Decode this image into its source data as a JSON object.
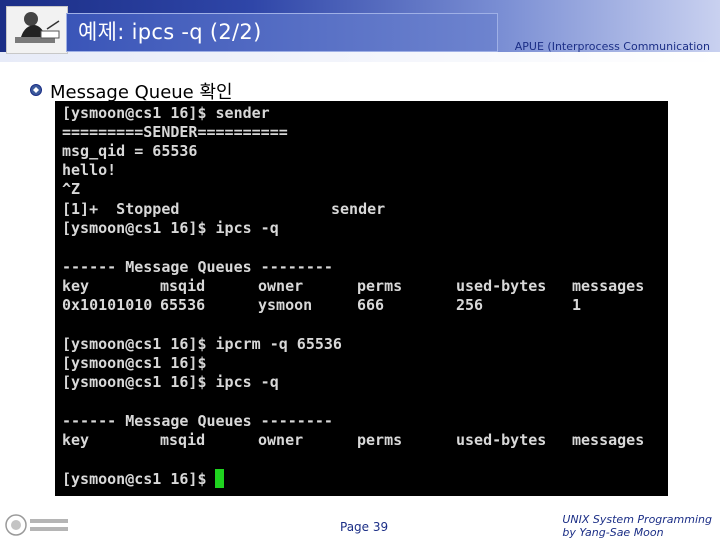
{
  "header": {
    "title": "예제: ipcs -q (2/2)",
    "course": "APUE (Interprocess Communication"
  },
  "bullet": {
    "text": "Message Queue 확인"
  },
  "terminal": {
    "lines": [
      "[ysmoon@cs1 16]$ sender",
      "=========SENDER==========",
      "msg_qid = 65536",
      "hello!",
      "^Z",
      "[ysmoon@cs1 16]$ ipcs -q",
      "",
      "------ Message Queues --------",
      "",
      "",
      "",
      "[ysmoon@cs1 16]$ ipcrm -q 65536",
      "[ysmoon@cs1 16]$",
      "[ysmoon@cs1 16]$ ipcs -q",
      "",
      "------ Message Queues --------",
      "",
      "",
      "[ysmoon@cs1 16]$ "
    ],
    "job_line": {
      "job": "[1]+  Stopped",
      "cmd": "sender"
    },
    "table1": {
      "headers": [
        "key",
        "msqid",
        "owner",
        "perms",
        "used-bytes",
        "messages"
      ],
      "row": [
        "0x10101010",
        "65536",
        "ysmoon",
        "666",
        "256",
        "1"
      ]
    },
    "table2": {
      "headers": [
        "key",
        "msqid",
        "owner",
        "perms",
        "used-bytes",
        "messages"
      ]
    }
  },
  "footer": {
    "page": "Page 39",
    "credit_line1": "UNIX System Programming",
    "credit_line2": "by Yang-Sae Moon"
  },
  "colors": {
    "header_dark": "#1b2e86",
    "terminal_bg": "#000000",
    "terminal_text": "#d8d8d8",
    "cursor": "#1fd31f"
  }
}
